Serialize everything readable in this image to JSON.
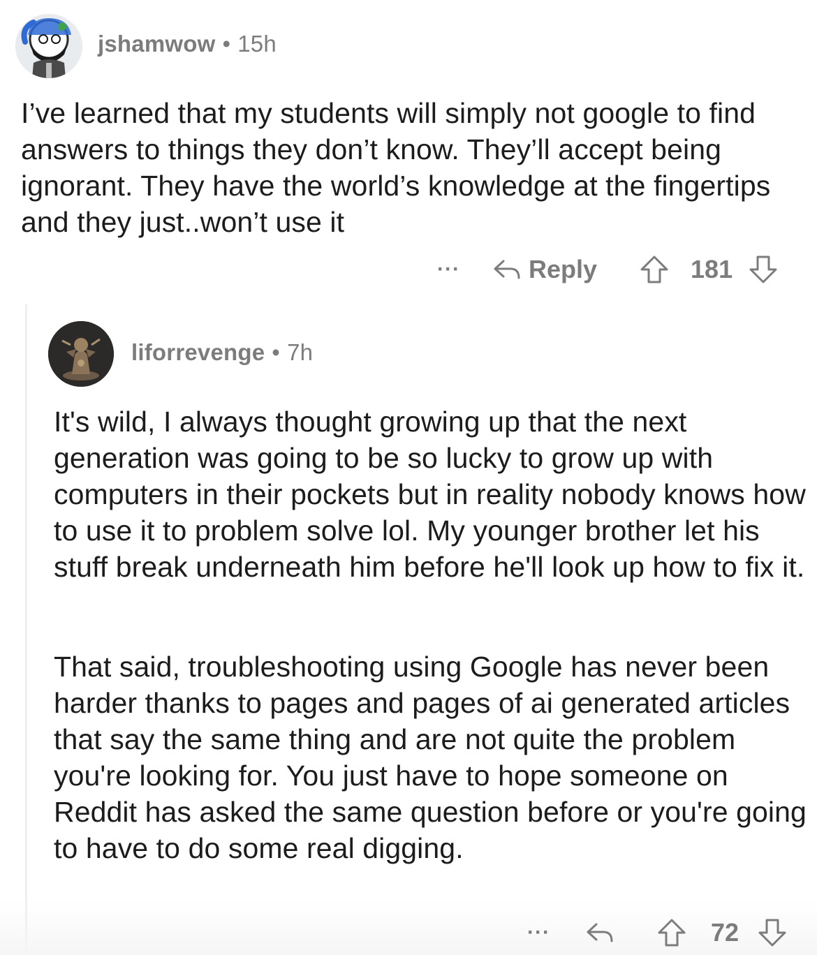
{
  "comments": [
    {
      "username": "jshamwow",
      "separator": "•",
      "time": "15h",
      "avatar_icon": "cartoon-avatar-icon",
      "body": "I’ve learned that my students will simply not google to find answers to things they don’t know. They’ll accept being ignorant. They have the world’s knowledge at the fingertips and they just..won’t use it",
      "actions": {
        "more_label": "···",
        "reply_label": "Reply",
        "score": "181"
      }
    },
    {
      "username": "liforrevenge",
      "separator": "•",
      "time": "7h",
      "avatar_icon": "miniature-figure-avatar-icon",
      "paragraphs": [
        "It's wild, I always thought growing up that the next generation was going to be so lucky to grow up with computers in their pockets but in reality nobody knows how to use it to problem solve lol. My younger brother let his stuff break underneath him before he'll look up how to fix it.",
        "That said, troubleshooting using Google has never been harder thanks to pages and pages of ai generated articles that say the same thing and are not quite the problem you're looking for. You just have to hope someone on Reddit has asked the same question before or you're going to have to do some real digging."
      ],
      "actions": {
        "more_label": "···",
        "score": "72"
      }
    }
  ],
  "colors": {
    "text": "#1c1c1c",
    "meta": "#7c7c7c",
    "thread_line": "#edeff1"
  }
}
